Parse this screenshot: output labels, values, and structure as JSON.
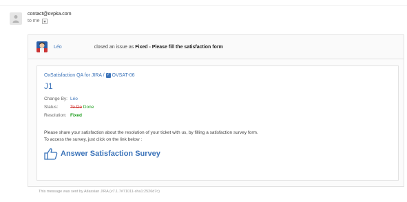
{
  "email": {
    "from": "contact@ovpka.com",
    "to_line": "to me"
  },
  "notification": {
    "user": "Léo",
    "action_text": "closed an issue as ",
    "action_strong": "Fixed - Please fill the satisfaction form"
  },
  "issue": {
    "project_path": "OxSatisfaction QA for JIRA / ",
    "key": "OVSAT-06",
    "title": "J1",
    "meta": {
      "change_by_label": "Change By:",
      "change_by_value": "Léo",
      "status_label": "Status:",
      "status_from": "To Do",
      "status_to": "Done",
      "resolution_label": "Resolution:",
      "resolution_value": "Fixed"
    }
  },
  "body": {
    "line1": "Please share your satisfaction about the resolution of your ticket with us, by filling a satisfaction survey form.",
    "line2": "To access the survey, just click on the link below :"
  },
  "survey": {
    "label": "Answer Satisfaction Survey"
  },
  "footer": {
    "note": "This message was sent by Atlassian JIRA (v7.1.7#71011-sha1:2526d7c)"
  },
  "colors": {
    "link": "#3b73b9",
    "todo": "#d0312d",
    "done": "#1a9c1a"
  }
}
